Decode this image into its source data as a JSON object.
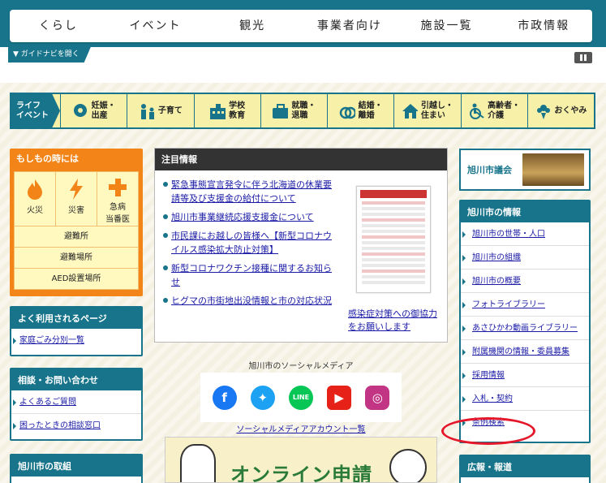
{
  "global_nav": [
    "くらし",
    "イベント",
    "観光",
    "事業者向け",
    "施設一覧",
    "市政情報"
  ],
  "guide_label": "▼ ガイドナビを開く",
  "life_event": {
    "label_line1": "ライフ",
    "label_line2": "イベント",
    "items": [
      {
        "l1": "妊娠・",
        "l2": "出産"
      },
      {
        "l1": "子育て",
        "l2": ""
      },
      {
        "l1": "学校",
        "l2": "教育"
      },
      {
        "l1": "就職・",
        "l2": "退職"
      },
      {
        "l1": "結婚・",
        "l2": "離婚"
      },
      {
        "l1": "引越し・",
        "l2": "住まい"
      },
      {
        "l1": "高齢者・",
        "l2": "介護"
      },
      {
        "l1": "おくやみ",
        "l2": ""
      }
    ]
  },
  "emergency": {
    "title": "もしもの時には",
    "cells": [
      {
        "line1": "火災",
        "line2": ""
      },
      {
        "line1": "災害",
        "line2": ""
      },
      {
        "line1": "急病",
        "line2": "当番医"
      }
    ],
    "links": [
      "避難所",
      "避難場所",
      "AED設置場所"
    ]
  },
  "frequent": {
    "title": "よく利用されるページ",
    "items": [
      "家庭ごみ分別一覧"
    ]
  },
  "consult": {
    "title": "相談・お問い合わせ",
    "items": [
      "よくあるご質問",
      "困ったときの相談窓口"
    ]
  },
  "efforts": {
    "title": "旭川市の取組"
  },
  "notice": {
    "title": "注目情報",
    "items": [
      "緊急事態宣言発令に伴う北海道の休業要請等及び支援金の給付について",
      "旭川市事業継続応援支援金について",
      "市民課にお越しの皆様へ【新型コロナウイルス感染拡大防止対策】",
      "新型コロナワクチン接種に関するお知らせ",
      "ヒグマの市街地出没情報と市の対応状況"
    ],
    "poster_caption": "感染症対策への御協力をお願いします"
  },
  "social": {
    "title": "旭川市のソーシャルメディア",
    "icons": [
      {
        "name": "facebook-icon",
        "glyph": "f",
        "color": "#1877f2"
      },
      {
        "name": "twitter-icon",
        "glyph": "✦",
        "color": "#1da1f2"
      },
      {
        "name": "line-icon",
        "glyph": "LINE",
        "color": "#06c755"
      },
      {
        "name": "youtube-icon",
        "glyph": "▶",
        "color": "#e62117"
      },
      {
        "name": "instagram-icon",
        "glyph": "◎",
        "color": "#c13584"
      }
    ],
    "link": "ソーシャルメディアアカウント一覧"
  },
  "banner_text": "オンライン申請",
  "council": {
    "label": "旭川市議会"
  },
  "city_info": {
    "title": "旭川市の情報",
    "items": [
      "旭川市の世帯・人口",
      "旭川市の組織",
      "旭川市の概要",
      "フォトライブラリー",
      "あさひかわ動画ライブラリー",
      "附属機関の情報・委員募集",
      "採用情報",
      "入札・契約",
      "条例検索"
    ]
  },
  "press": {
    "title": "広報・報道"
  },
  "colors": {
    "primary": "#17748a",
    "orange": "#f28418",
    "highlight": "#e5172a"
  }
}
